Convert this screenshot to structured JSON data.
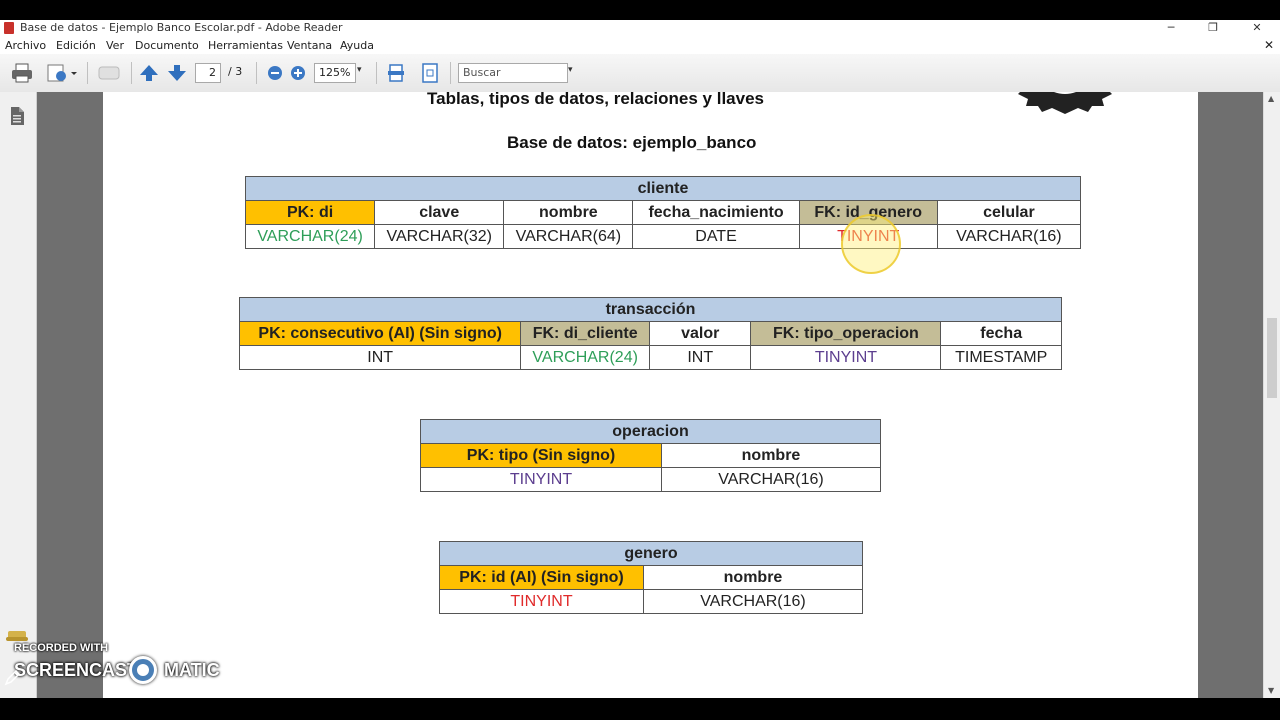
{
  "window": {
    "title": "Base de datos - Ejemplo Banco Escolar.pdf - Adobe Reader",
    "controls": {
      "minimize": "─",
      "restore": "❐",
      "close": "✕"
    }
  },
  "menu": {
    "items": [
      "Archivo",
      "Edición",
      "Ver",
      "Documento",
      "Herramientas",
      "Ventana",
      "Ayuda"
    ],
    "close": "✕"
  },
  "toolbar": {
    "page_current": "2",
    "page_total": "/ 3",
    "zoom": "125%",
    "search_placeholder": "Buscar"
  },
  "document": {
    "heading_top": "Tablas, tipos de datos, relaciones y llaves",
    "heading_db": "Base de datos: ejemplo_banco",
    "tables": [
      {
        "name": "cliente",
        "columns": [
          "PK: di",
          "clave",
          "nombre",
          "fecha_nacimiento",
          "FK: id_genero",
          "celular"
        ],
        "types": [
          "VARCHAR(24)",
          "VARCHAR(32)",
          "VARCHAR(64)",
          "DATE",
          "TINYINT",
          "VARCHAR(16)"
        ]
      },
      {
        "name": "transacción",
        "columns": [
          "PK: consecutivo (AI) (Sin signo)",
          "FK: di_cliente",
          "valor",
          "FK: tipo_operacion",
          "fecha"
        ],
        "types": [
          "INT",
          "VARCHAR(24)",
          "INT",
          "TINYINT",
          "TIMESTAMP"
        ]
      },
      {
        "name": "operacion",
        "columns": [
          "PK: tipo (Sin signo)",
          "nombre"
        ],
        "types": [
          "TINYINT",
          "VARCHAR(16)"
        ]
      },
      {
        "name": "genero",
        "columns": [
          "PK: id (AI) (Sin signo)",
          "nombre"
        ],
        "types": [
          "TINYINT",
          "VARCHAR(16)"
        ]
      }
    ]
  },
  "colors": {
    "pk_header": "#ffc000",
    "fk_header": "#c4bd97",
    "table_title": "#b8cce4",
    "varchar_pk_link": "#2e9e58",
    "tinyint_genero": "#e02b2b",
    "tinyint_operacion": "#5c3e8f"
  },
  "watermark": {
    "line1": "RECORDED WITH",
    "brand_left": "SCREENCAST",
    "brand_right": "MATIC"
  }
}
